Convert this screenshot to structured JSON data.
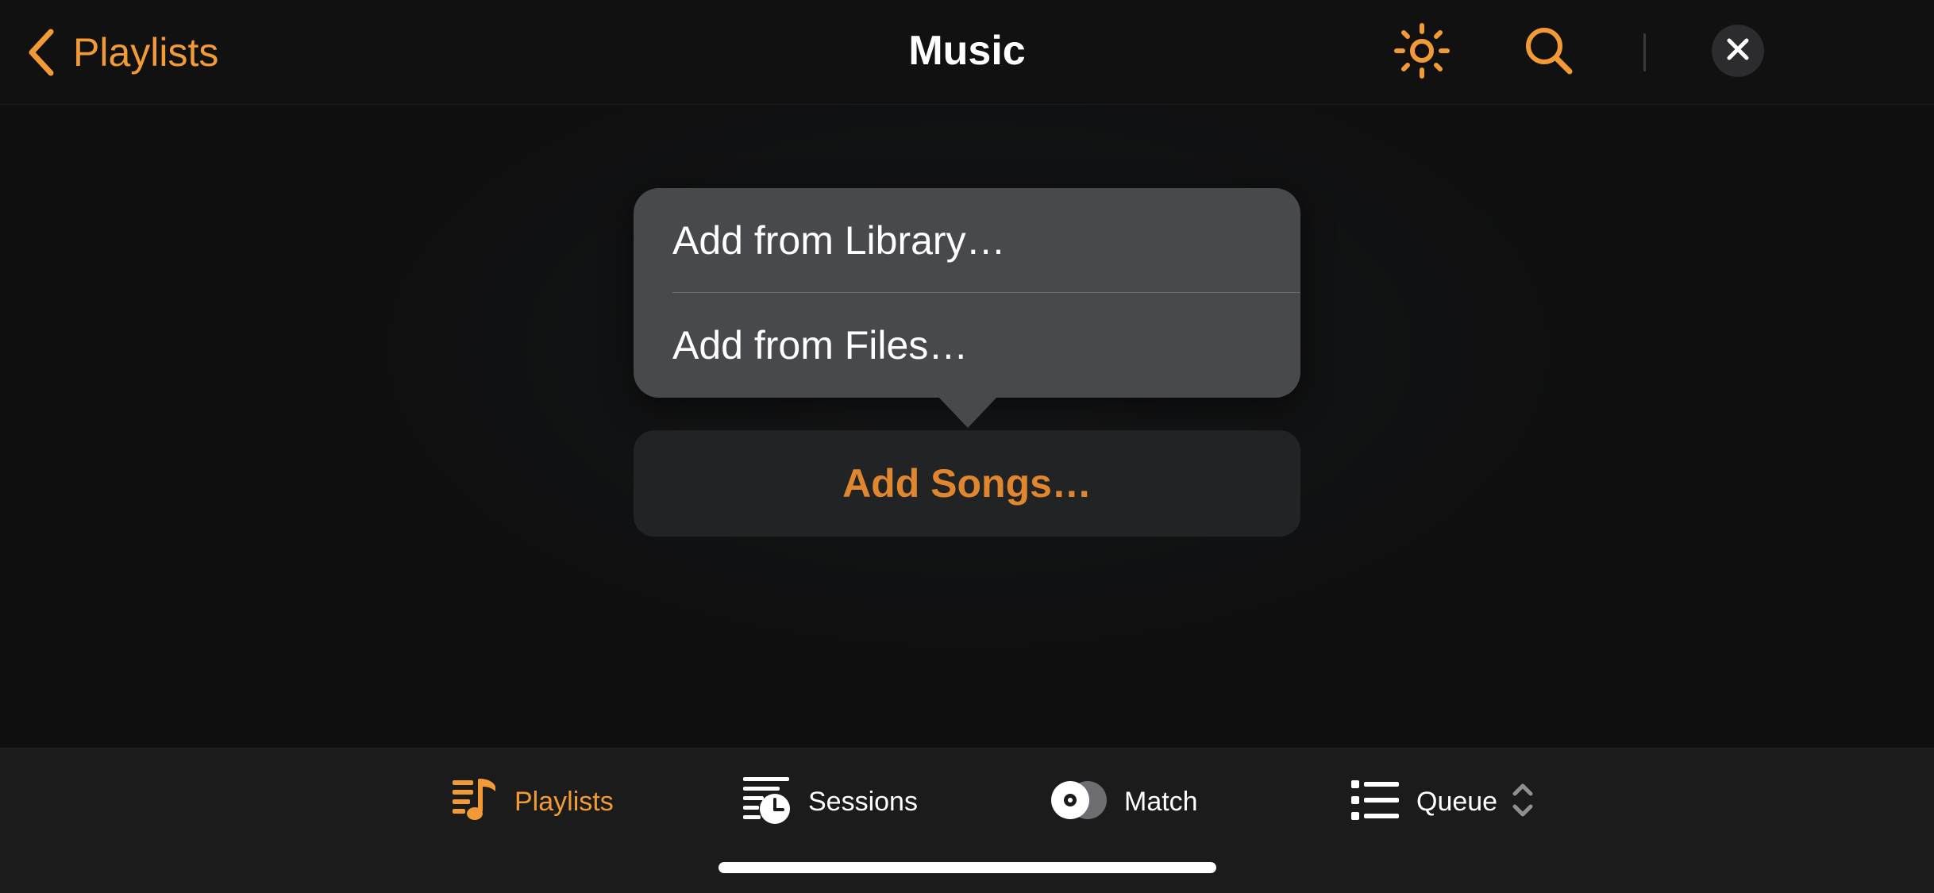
{
  "nav": {
    "back_label": "Playlists",
    "title": "Music",
    "icons": [
      "chevron-left-icon",
      "sun-icon",
      "search-icon",
      "close-icon"
    ]
  },
  "popover": {
    "items": [
      {
        "label": "Add from Library…"
      },
      {
        "label": "Add from Files…"
      }
    ]
  },
  "main": {
    "add_songs_label": "Add Songs…"
  },
  "tabbar": {
    "tabs": [
      {
        "label": "Playlists",
        "icon": "playlist-music-icon",
        "active": true
      },
      {
        "label": "Sessions",
        "icon": "sessions-clock-icon",
        "active": false
      },
      {
        "label": "Match",
        "icon": "match-disc-icon",
        "active": false
      },
      {
        "label": "Queue",
        "icon": "queue-list-icon",
        "active": false
      }
    ]
  },
  "colors": {
    "accent": "#f29b36",
    "accent_button": "#e0862f",
    "background": "#0f0f10",
    "popover": "#48494d",
    "tabbar": "#1b1b1c"
  }
}
